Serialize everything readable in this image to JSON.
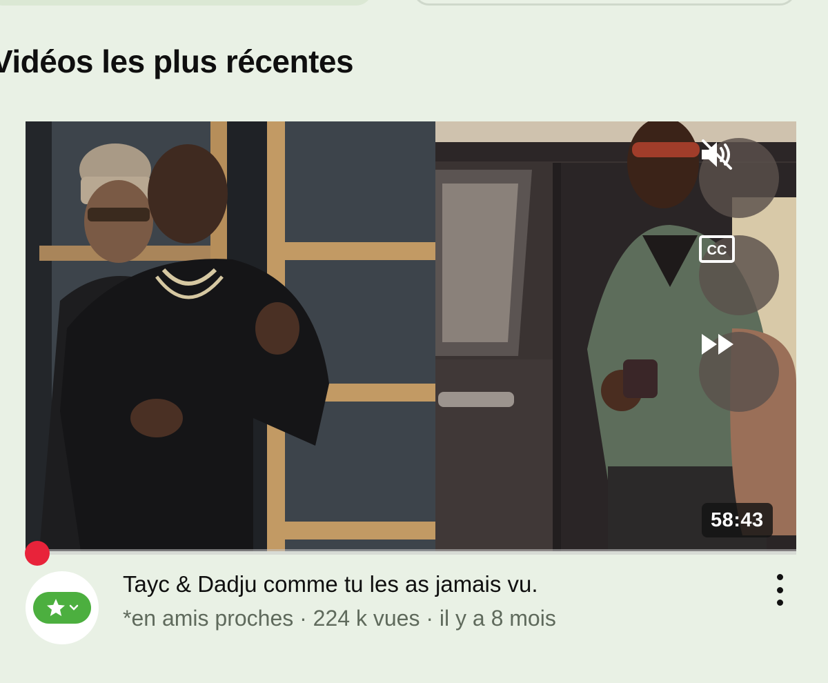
{
  "section": {
    "title": "Vidéos les plus récentes"
  },
  "video": {
    "title": "Tayc & Dadju comme tu les as jamais vu.",
    "channel": "*en amis proches",
    "separator": " · ",
    "views": "224 k vues",
    "age": "il y a 8 mois",
    "duration": "58:43",
    "progress_fraction": 0.015,
    "controls": {
      "mute_icon": "volume-muted-icon",
      "cc_icon": "closed-captions-icon",
      "cc_label": "CC",
      "next_icon": "fast-forward-icon"
    }
  },
  "avatar": {
    "icon": "star-icon",
    "chevron": "chevron-down-icon",
    "color": "#4caf3f"
  },
  "colors": {
    "background": "#e9f1e5",
    "progress": "#e8233a"
  }
}
